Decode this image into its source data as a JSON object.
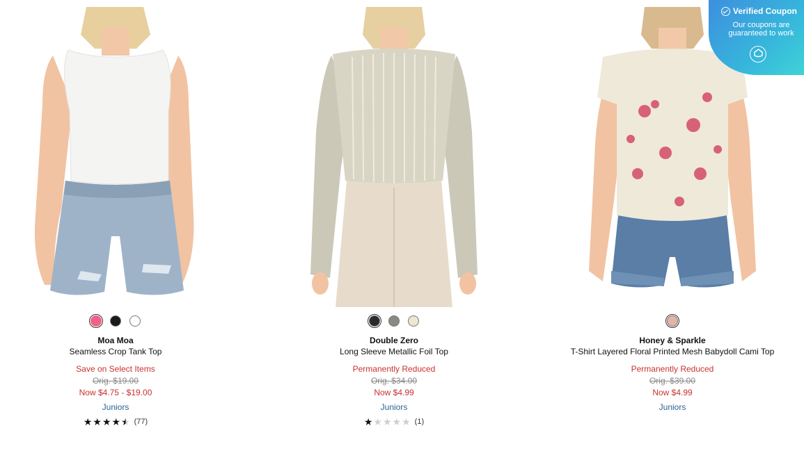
{
  "products": [
    {
      "brand": "Moa Moa",
      "name": "Seamless Crop Tank Top",
      "swatches": [
        "#f06289",
        "#1a1a1a",
        "#ffffff"
      ],
      "promo": "Save on Select Items",
      "orig": "Orig. $19.00",
      "now": "Now $4.75 - $19.00",
      "department": "Juniors",
      "rating": 4.5,
      "review_count": "(77)"
    },
    {
      "brand": "Double Zero",
      "name": "Long Sleeve Metallic Foil Top",
      "swatches": [
        "#2a2a2a",
        "#8a8a82",
        "#ece6d2"
      ],
      "promo": "Permanently Reduced",
      "orig": "Orig. $34.00",
      "now": "Now $4.99",
      "department": "Juniors",
      "rating": 1,
      "review_count": "(1)"
    },
    {
      "brand": "Honey & Sparkle",
      "name": "T-Shirt Layered Floral Printed Mesh Babydoll Cami Top",
      "swatches": [
        "#e6b3ab"
      ],
      "promo": "Permanently Reduced",
      "orig": "Orig. $39.00",
      "now": "Now $4.99",
      "department": "Juniors"
    }
  ],
  "coupon": {
    "title": "Verified Coupon",
    "subtitle_line1": "Our coupons are",
    "subtitle_line2": "guaranteed to work"
  }
}
